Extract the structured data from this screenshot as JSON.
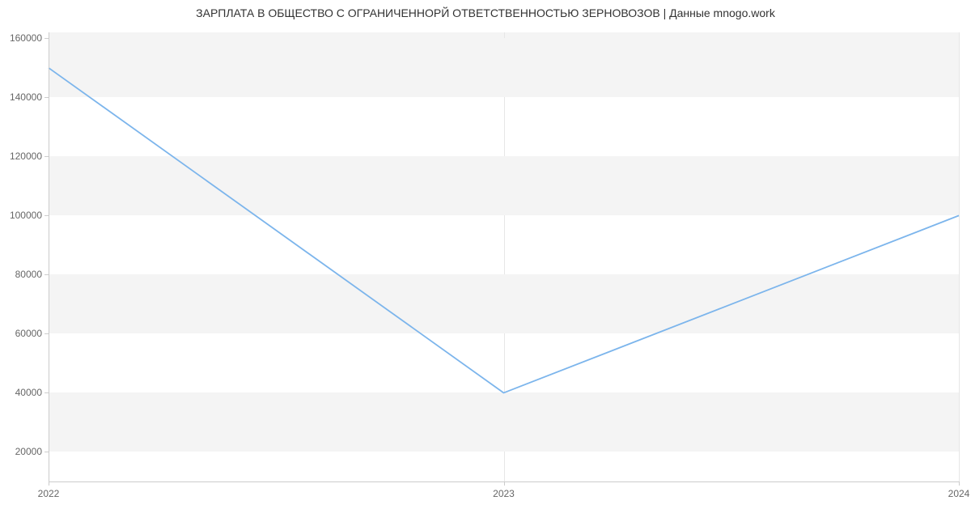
{
  "chart_data": {
    "type": "line",
    "title": "ЗАРПЛАТА В ОБЩЕСТВО С ОГРАНИЧЕННОРЙ ОТВЕТСТВЕННОСТЬЮ ЗЕРНОВОЗОВ | Данные mnogo.work",
    "x": [
      2022,
      2023,
      2024
    ],
    "values": [
      150000,
      40000,
      100000
    ],
    "x_ticks": [
      2022,
      2023,
      2024
    ],
    "y_ticks": [
      20000,
      40000,
      60000,
      80000,
      100000,
      120000,
      140000,
      160000
    ],
    "xlim": [
      2022,
      2024
    ],
    "ylim": [
      10000,
      162000
    ],
    "line_color": "#7cb5ec",
    "band_color": "#f4f4f4",
    "grid_on": true
  }
}
